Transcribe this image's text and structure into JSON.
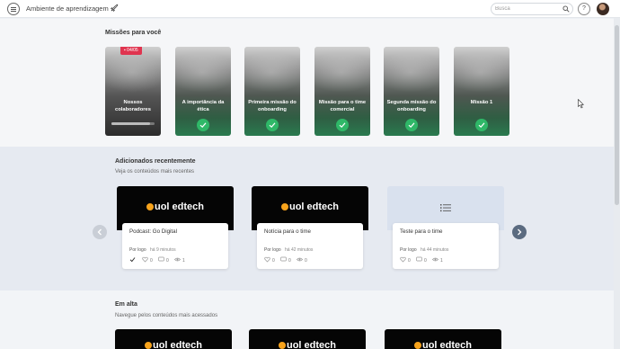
{
  "header": {
    "app_title": "Ambiente de aprendizagem",
    "search": {
      "placeholder": "Busca",
      "value": ""
    },
    "help_label": "?"
  },
  "missions": {
    "title": "Missões para você",
    "items": [
      {
        "title": "Nossos colaboradores",
        "status": "in_progress",
        "date_badge": "04/05",
        "progress": 0.9
      },
      {
        "title": "A importância da ética",
        "status": "completed"
      },
      {
        "title": "Primeira missão do onboarding",
        "status": "completed"
      },
      {
        "title": "Missão para o time comercial",
        "status": "completed"
      },
      {
        "title": "Segunda missão do onboarding",
        "status": "completed"
      },
      {
        "title": "Missão 1",
        "status": "completed"
      }
    ]
  },
  "recent": {
    "title": "Adicionados recentemente",
    "subtitle": "Veja os conteúdos mais recentes",
    "cards": [
      {
        "title": "Podcast: Go Digital",
        "author": "Por logo",
        "time": "há 9 minutos",
        "likes": "0",
        "comments": "0",
        "views": "1",
        "thumb": "uol-edtech",
        "logo": "uol edtech",
        "tagline": "",
        "done": true
      },
      {
        "title": "Notícia para o time",
        "author": "Por logo",
        "time": "há 42 minutos",
        "likes": "0",
        "comments": "0",
        "views": "0",
        "thumb": "uol-edtech",
        "logo": "uol edtech",
        "tagline": "",
        "done": false
      },
      {
        "title": "Teste para o time",
        "author": "Por logo",
        "time": "há 44 minutos",
        "likes": "0",
        "comments": "0",
        "views": "1",
        "thumb": "list",
        "done": false
      }
    ]
  },
  "trending": {
    "title": "Em alta",
    "subtitle": "Navegue pelos conteúdos mais acessados",
    "cards": [
      {
        "logo": "uol edtech"
      },
      {
        "logo": "uol edtech"
      },
      {
        "logo": "uol edtech"
      }
    ]
  },
  "colors": {
    "accent_green": "#2fb868",
    "badge_red": "#e0344f",
    "arrow_active": "#5b6b80"
  }
}
